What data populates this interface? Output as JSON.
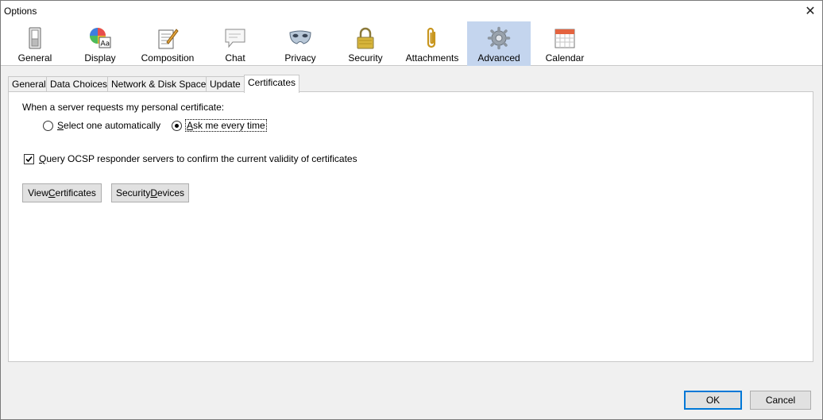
{
  "window": {
    "title": "Options",
    "close_glyph": "✕"
  },
  "toolbar": {
    "panes": [
      {
        "label": "General",
        "icon": "switch-icon"
      },
      {
        "label": "Display",
        "icon": "display-palette-icon"
      },
      {
        "label": "Composition",
        "icon": "composition-notepad-icon"
      },
      {
        "label": "Chat",
        "icon": "chat-bubble-icon"
      },
      {
        "label": "Privacy",
        "icon": "privacy-mask-icon"
      },
      {
        "label": "Security",
        "icon": "padlock-icon"
      },
      {
        "label": "Attachments",
        "icon": "paperclip-icon"
      },
      {
        "label": "Advanced",
        "icon": "gear-icon",
        "selected": true
      },
      {
        "label": "Calendar",
        "icon": "calendar-icon"
      }
    ]
  },
  "subtabs": [
    {
      "label": "General"
    },
    {
      "label": "Data Choices"
    },
    {
      "label": "Network & Disk Space"
    },
    {
      "label": "Update"
    },
    {
      "label": "Certificates",
      "active": true
    }
  ],
  "certificates": {
    "request_label": "When a server requests my personal certificate:",
    "option_auto": {
      "pre": "",
      "key": "S",
      "post": "elect one automatically",
      "checked": false
    },
    "option_ask": {
      "pre": "",
      "key": "A",
      "post": "sk me every time",
      "checked": true
    },
    "ocsp": {
      "pre": "",
      "key": "Q",
      "post": "uery OCSP responder servers to confirm the current validity of certificates",
      "checked": true
    },
    "view_certificates": {
      "pre": "View ",
      "key": "C",
      "post": "ertificates"
    },
    "security_devices": {
      "pre": "Security ",
      "key": "D",
      "post": "evices"
    }
  },
  "footer": {
    "ok_label": "OK",
    "cancel_label": "Cancel"
  },
  "colors": {
    "selected_pane": "#c4d5ee",
    "default_button_border": "#0078d7"
  }
}
